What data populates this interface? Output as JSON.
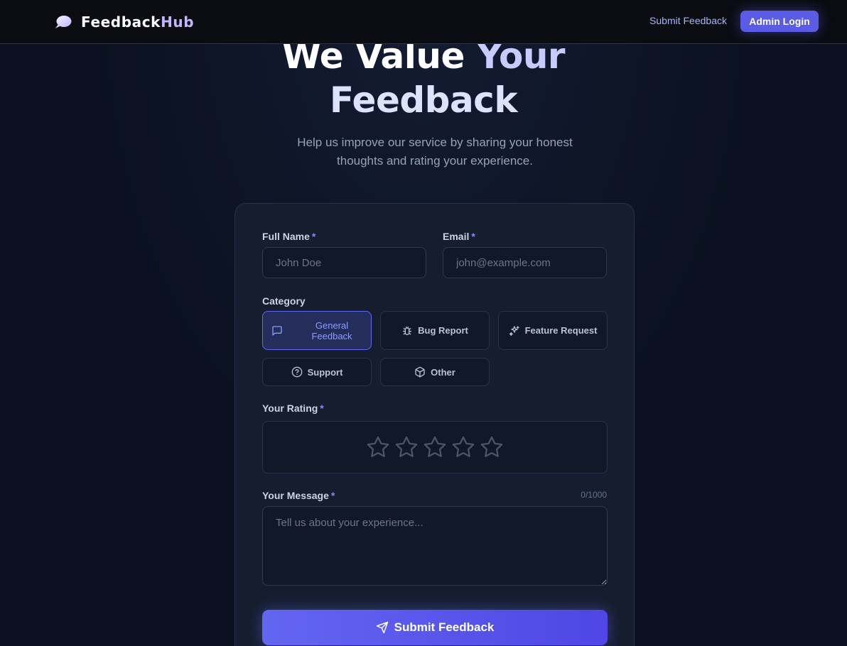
{
  "nav": {
    "brand_first": "Feedback",
    "brand_second": "Hub",
    "brand_icon": "speech-bubble-icon",
    "link_submit": "Submit Feedback",
    "admin_login": "Admin Login"
  },
  "hero": {
    "title_part1": "We Value",
    "title_part2": "Your",
    "title_line2": "Feedback",
    "subtitle": "Help us improve our service by sharing your honest thoughts and rating your experience."
  },
  "form": {
    "full_name": {
      "label": "Full Name",
      "required": "*",
      "placeholder": "John Doe",
      "value": ""
    },
    "email": {
      "label": "Email",
      "required": "*",
      "placeholder": "john@example.com",
      "value": ""
    },
    "category": {
      "label": "Category",
      "options": [
        {
          "label": "General Feedback",
          "icon": "message-square-icon",
          "selected": true
        },
        {
          "label": "Bug Report",
          "icon": "bug-icon",
          "selected": false
        },
        {
          "label": "Feature Request",
          "icon": "sparkles-icon",
          "selected": false
        },
        {
          "label": "Support",
          "icon": "help-circle-icon",
          "selected": false
        },
        {
          "label": "Other",
          "icon": "box-icon",
          "selected": false
        }
      ]
    },
    "rating": {
      "label": "Your Rating",
      "required": "*",
      "max": 5,
      "value": 0
    },
    "message": {
      "label": "Your Message",
      "required": "*",
      "placeholder": "Tell us about your experience...",
      "counter": "0/1000",
      "value": ""
    },
    "submit_label": "Submit Feedback"
  },
  "colors": {
    "background": "#0b1120",
    "card": "#151d2e",
    "accent": "#6366f1",
    "accent_light": "#a5b4fc",
    "active_category_bg": "#252d5a"
  }
}
